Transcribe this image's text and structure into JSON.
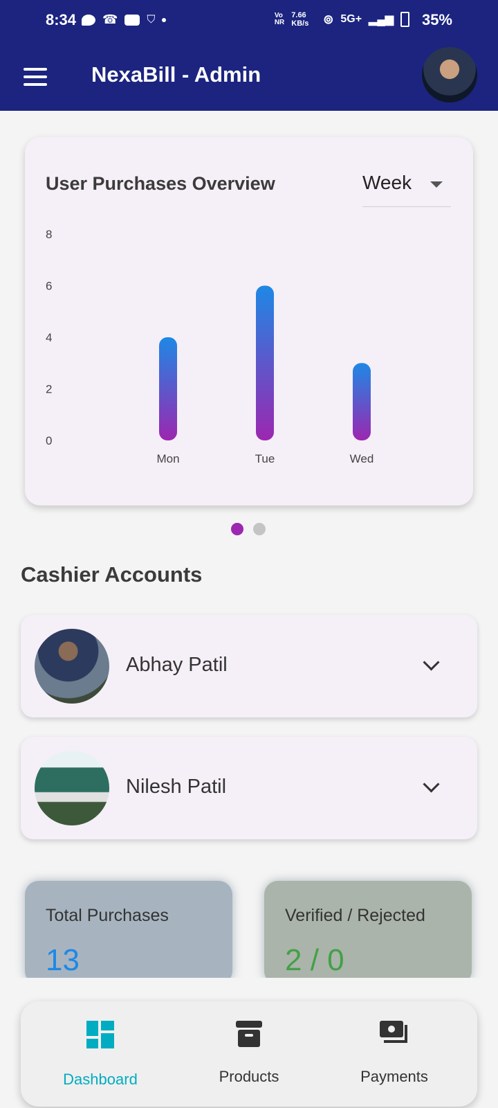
{
  "status_bar": {
    "time": "8:34",
    "net_speed": "7.66 KB/s",
    "network": "5G+",
    "battery": "35%"
  },
  "app_bar": {
    "title": "NexaBill - Admin"
  },
  "chart_card": {
    "title": "User Purchases Overview",
    "range_selected": "Week"
  },
  "chart_data": {
    "type": "bar",
    "categories": [
      "Mon",
      "Tue",
      "Wed"
    ],
    "values": [
      4,
      6,
      3
    ],
    "y_ticks": [
      0,
      2,
      4,
      6,
      8
    ],
    "ylim": [
      0,
      8
    ],
    "grid": false,
    "bar_gradient": [
      "#1e88e5",
      "#9c27b0"
    ]
  },
  "pager": {
    "count": 2,
    "active_index": 0
  },
  "cashiers": {
    "section_title": "Cashier Accounts",
    "items": [
      {
        "name": "Abhay Patil"
      },
      {
        "name": "Nilesh Patil"
      }
    ]
  },
  "stats": {
    "total_purchases_label": "Total Purchases",
    "total_purchases_value": "13",
    "verified_label": "Verified / Rejected",
    "verified_value": "2 / 0"
  },
  "bottom_nav": {
    "items": [
      {
        "label": "Dashboard",
        "icon": "dashboard-icon",
        "active": true
      },
      {
        "label": "Products",
        "icon": "archive-icon",
        "active": false
      },
      {
        "label": "Payments",
        "icon": "payments-icon",
        "active": false
      }
    ]
  },
  "colors": {
    "primary": "#1c2480",
    "accent_active": "#00acc1",
    "total_value": "#1e88e5",
    "verified_value": "#43a047"
  }
}
